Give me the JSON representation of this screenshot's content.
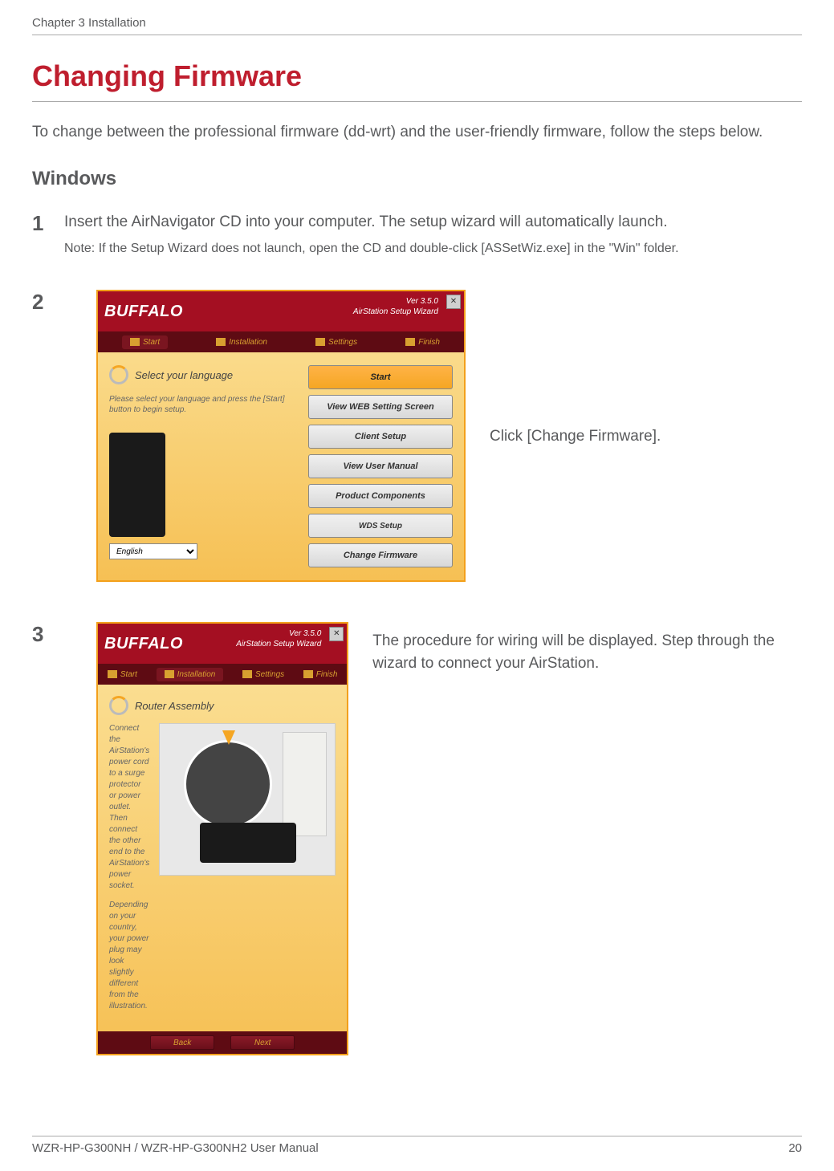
{
  "header": {
    "chapter": "Chapter 3  Installation"
  },
  "title": "Changing Firmware",
  "intro": "To change between the professional firmware (dd-wrt) and the user-friendly firmware, follow the steps below.",
  "section": "Windows",
  "steps": {
    "s1": {
      "num": "1",
      "text": "Insert the AirNavigator CD into your computer. The setup wizard will automatically launch.",
      "note": "Note:   If the Setup Wizard does not launch, open the CD and double-click [ASSetWiz.exe] in the \"Win\" folder."
    },
    "s2": {
      "num": "2",
      "side": "Click [Change Firmware]."
    },
    "s3": {
      "num": "3",
      "side": "The procedure for wiring will be displayed. Step through the wizard to connect your AirStation."
    }
  },
  "wizard": {
    "logo": "BUFFALO",
    "version": "Ver 3.5.0",
    "subtitle": "AirStation Setup Wizard",
    "tabs": {
      "start": "Start",
      "install": "Installation",
      "settings": "Settings",
      "finish": "Finish"
    },
    "lang": {
      "title": "Select your language",
      "hint": "Please select your language and press the [Start] button to begin setup.",
      "selected": "English"
    },
    "buttons": {
      "start": "Start",
      "view_web": "View WEB Setting Screen",
      "client": "Client Setup",
      "manual": "View User Manual",
      "components": "Product Components",
      "wds": "WDS Setup",
      "change_fw": "Change Firmware"
    },
    "assembly": {
      "title": "Router Assembly",
      "p1": "Connect the AirStation's power cord to a surge protector or power outlet. Then connect the other end to the AirStation's power socket.",
      "p2": "Depending on your country, your power plug may look slightly different from the illustration."
    },
    "nav": {
      "back": "Back",
      "next": "Next"
    }
  },
  "footer": {
    "manual": "WZR-HP-G300NH / WZR-HP-G300NH2 User Manual",
    "page": "20"
  }
}
